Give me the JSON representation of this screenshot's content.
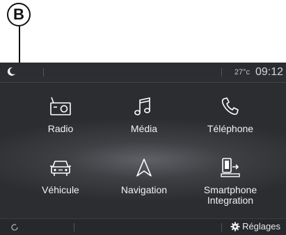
{
  "callout": {
    "letter": "B"
  },
  "statusbar": {
    "night_mode_icon": "moon-icon",
    "temperature": "27°c",
    "time": "09:12"
  },
  "tiles": [
    {
      "label": "Radio",
      "icon": "radio-icon"
    },
    {
      "label": "Média",
      "icon": "music-note-icon"
    },
    {
      "label": "Téléphone",
      "icon": "phone-icon"
    },
    {
      "label": "Véhicule",
      "icon": "car-icon"
    },
    {
      "label": "Navigation",
      "icon": "navigation-arrow-icon"
    },
    {
      "label_line1": "Smartphone",
      "label_line2": "Integration",
      "icon": "smartphone-projection-icon"
    }
  ],
  "bottombar": {
    "left_icon": "refresh-icon",
    "settings_label": "Réglages",
    "settings_icon": "gear-icon"
  },
  "colors": {
    "screen_background": "#2b2d31",
    "text": "#f2f2f2",
    "callout": "#111111"
  }
}
